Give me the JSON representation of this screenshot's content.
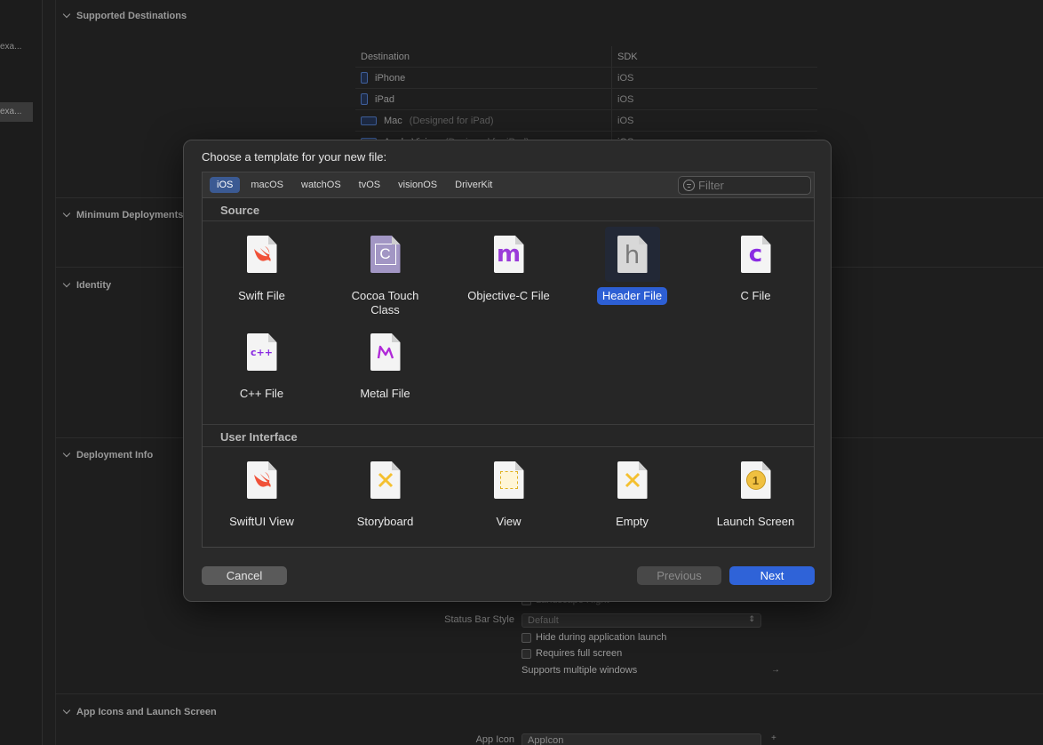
{
  "sidebar": {
    "items": [
      "exa...",
      "exa..."
    ]
  },
  "sections": {
    "supported_destinations": "Supported Destinations",
    "minimum_deployments": "Minimum Deployments",
    "identity": "Identity",
    "deployment_info": "Deployment Info",
    "app_icons": "App Icons and Launch Screen"
  },
  "destinations": {
    "col_destination": "Destination",
    "col_sdk": "SDK",
    "rows": [
      {
        "name": "iPhone",
        "suffix": "",
        "sdk": "iOS"
      },
      {
        "name": "iPad",
        "suffix": "",
        "sdk": "iOS"
      },
      {
        "name": "Mac",
        "suffix": "(Designed for iPad)",
        "sdk": "iOS"
      },
      {
        "name": "Apple Vision",
        "suffix": "(Designed for iPad)",
        "sdk": "iOS"
      }
    ]
  },
  "deployment": {
    "landscape_right": "Landscape Right",
    "status_bar_label": "Status Bar Style",
    "status_bar_value": "Default",
    "hide_launch": "Hide during application launch",
    "full_screen": "Requires full screen",
    "multiple_windows": "Supports multiple windows",
    "arrow": "→"
  },
  "app_icon": {
    "label": "App Icon",
    "value": "AppIcon",
    "plus": "+"
  },
  "dialog": {
    "title": "Choose a template for your new file:",
    "tabs": [
      "iOS",
      "macOS",
      "watchOS",
      "tvOS",
      "visionOS",
      "DriverKit"
    ],
    "active_tab": "iOS",
    "filter_placeholder": "Filter",
    "groups": {
      "source": "Source",
      "user_interface": "User Interface"
    },
    "source_items": [
      {
        "label": "Swift File",
        "glyph": ""
      },
      {
        "label": "Cocoa Touch\nClass",
        "glyph": "C"
      },
      {
        "label": "Objective-C File",
        "glyph": "m"
      },
      {
        "label": "Header File",
        "glyph": "h"
      },
      {
        "label": "C File",
        "glyph": "c"
      },
      {
        "label": "C++ File",
        "glyph": "c++"
      },
      {
        "label": "Metal File",
        "glyph": "M"
      }
    ],
    "ui_items": [
      {
        "label": "SwiftUI View"
      },
      {
        "label": "Storyboard"
      },
      {
        "label": "View"
      },
      {
        "label": "Empty"
      },
      {
        "label": "Launch Screen",
        "glyph": "1"
      }
    ],
    "selected": "Header File",
    "buttons": {
      "cancel": "Cancel",
      "previous": "Previous",
      "next": "Next"
    }
  }
}
